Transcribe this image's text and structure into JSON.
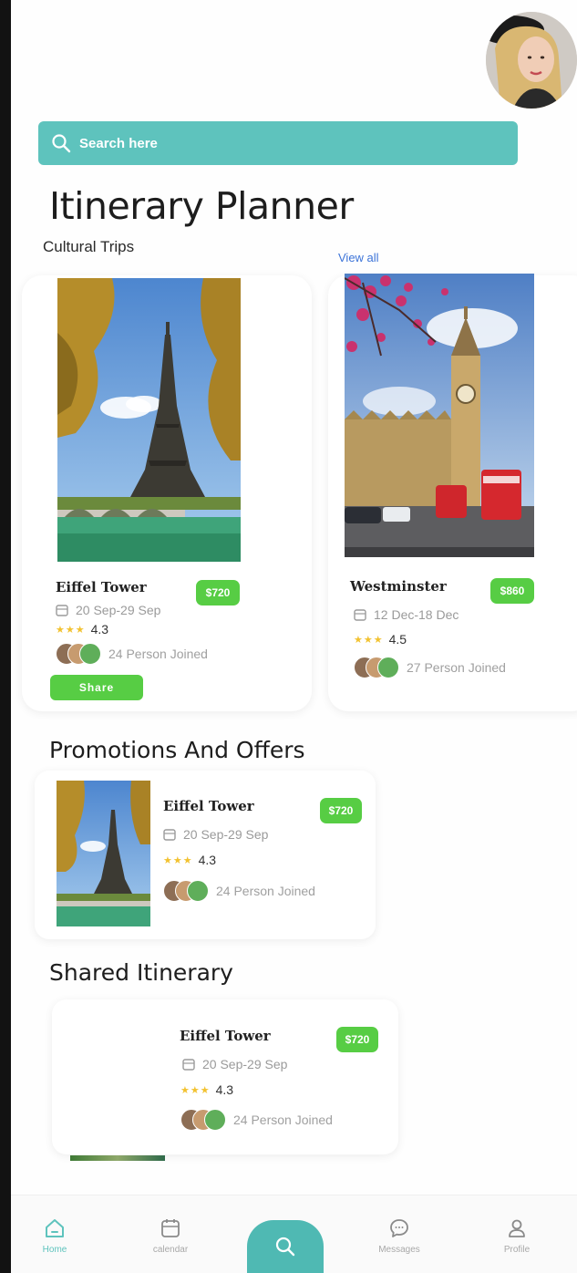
{
  "search": {
    "placeholder": "Search here",
    "icon": "search-icon"
  },
  "header": {
    "title": "Itinerary Planner",
    "subtitle": "Cultural Trips",
    "view_all": "View all"
  },
  "trips": [
    {
      "name": "Eiffel Tower",
      "price": "$720",
      "dates": "20 Sep-29 Sep",
      "rating": "4.3",
      "joined": "24 Person Joined",
      "share_label": "Share"
    },
    {
      "name": "Westminster",
      "price": "$860",
      "dates": "12 Dec-18 Dec",
      "rating": "4.5",
      "joined": "27 Person Joined"
    }
  ],
  "promotions": {
    "title": "Promotions And Offers",
    "item": {
      "name": "Eiffel Tower",
      "price": "$720",
      "dates": "20 Sep-29 Sep",
      "rating": "4.3",
      "joined": "24 Person Joined"
    }
  },
  "shared": {
    "title": "Shared Itinerary",
    "item": {
      "name": "Eiffel Tower",
      "price": "$720",
      "dates": "20 Sep-29 Sep",
      "rating": "4.3",
      "joined": "24 Person Joined"
    }
  },
  "nav": {
    "home": "Home",
    "calendar": "calendar",
    "messages": "Messages",
    "profile": "Profile"
  },
  "colors": {
    "accent": "#5ec3bd",
    "price_green": "#57cd44",
    "star": "#f2c230",
    "link": "#3d74d8"
  }
}
